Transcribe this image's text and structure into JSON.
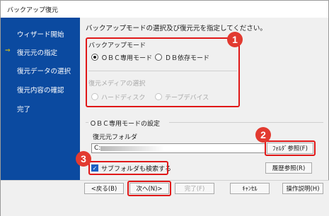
{
  "window": {
    "title": "バックアップ復元"
  },
  "sidebar": {
    "items": [
      {
        "label": "ウィザード開始",
        "current": false
      },
      {
        "label": "復元元の指定",
        "current": true
      },
      {
        "label": "復元データの選択",
        "current": false
      },
      {
        "label": "復元内容の確認",
        "current": false
      },
      {
        "label": "完了",
        "current": false
      }
    ],
    "current_marker": "⇒"
  },
  "main": {
    "instruction": "バックアップモードの選択及び復元元を指定してください。",
    "backup_mode": {
      "title": "バックアップモード",
      "options": [
        {
          "label": "ＯＢＣ専用モード",
          "selected": true
        },
        {
          "label": "ＤＢ依存モード",
          "selected": false
        }
      ]
    },
    "media": {
      "title": "復元メディアの選択",
      "options": [
        {
          "label": "ハードディスク",
          "selected": false
        },
        {
          "label": "テープデバイス",
          "selected": false
        }
      ]
    },
    "obc_settings": {
      "title": "ＯＢＣ専用モードの設定",
      "folder_label": "復元元フォルダ",
      "folder_value": "C:",
      "browse_button": "ﾌｫﾙﾀﾞ参照(F)",
      "subfolder_checkbox": "サブフォルダも検索する",
      "subfolder_checked": true,
      "history_button": "履歴参照(R)"
    }
  },
  "footer": {
    "back": "<戻る(B)",
    "next": "次へ(N)>",
    "finish": "完了(F)",
    "cancel": "ｷｬﾝｾﾙ",
    "manual": "操作説明(H)"
  },
  "annotations": [
    "1",
    "2",
    "3"
  ],
  "colors": {
    "sidebar": "#0b4aa0",
    "annotation": "#e01818",
    "badge": "#e23a30",
    "checkbox": "#1a5fc4"
  }
}
